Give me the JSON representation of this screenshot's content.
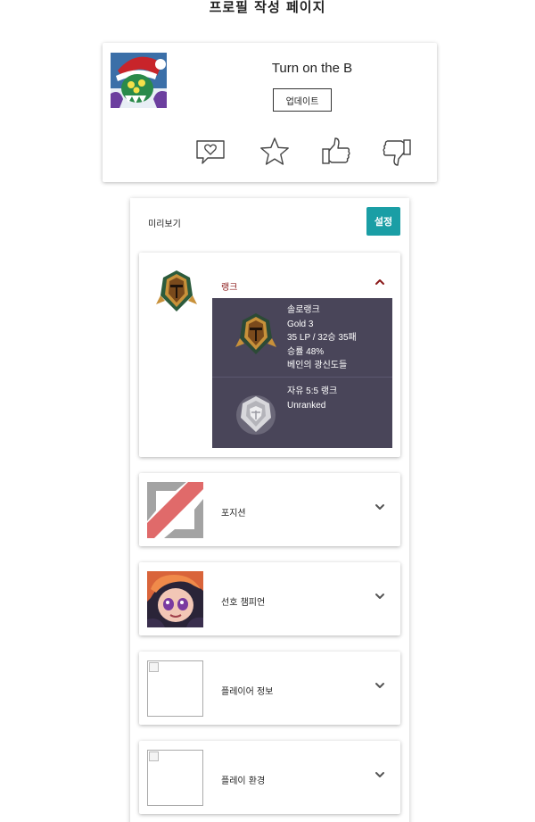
{
  "page": {
    "title": "프로필 작성 페이지"
  },
  "profile": {
    "name": "Turn on the B",
    "update_label": "업데이트",
    "actions": [
      {
        "name": "comment-heart-icon"
      },
      {
        "name": "star-icon"
      },
      {
        "name": "thumbs-up-icon"
      },
      {
        "name": "thumbs-down-icon"
      }
    ]
  },
  "preview": {
    "label": "미리보기",
    "settings_label": "설정",
    "accent_color": "#1a9ea5",
    "rank": {
      "title": "랭크",
      "solo": {
        "queue": "솔로랭크",
        "tier": "Gold 3",
        "record": "35 LP / 32승 35패",
        "winrate": "승률 48%",
        "league": "베인의 광신도들"
      },
      "flex": {
        "queue": "자유 5:5 랭크",
        "tier": "Unranked"
      }
    },
    "sections": {
      "position": {
        "title": "포지션"
      },
      "champion": {
        "title": "선호 챔피언"
      },
      "player_info": {
        "title": "플레이어 정보"
      },
      "environment": {
        "title": "플레이 환경"
      }
    }
  }
}
